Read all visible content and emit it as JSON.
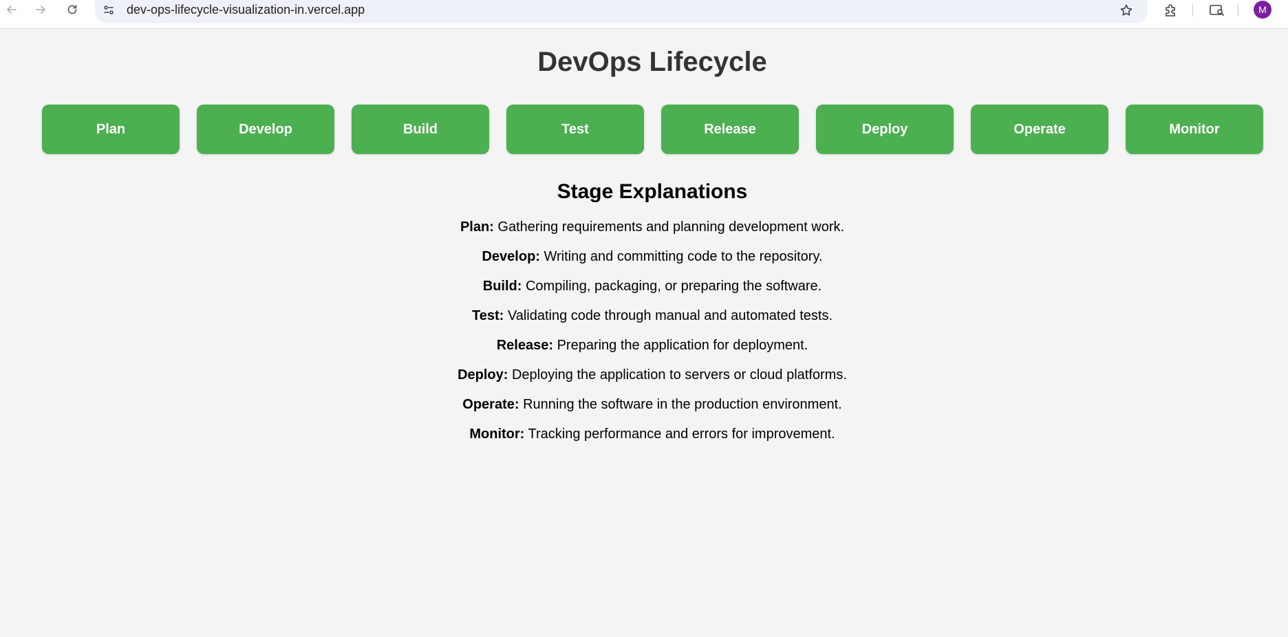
{
  "browser": {
    "url": "dev-ops-lifecycle-visualization-in.vercel.app",
    "profile_initial": "M",
    "icons": [
      "back-icon",
      "forward-icon",
      "reload-icon",
      "site-info-icon",
      "star-icon",
      "extensions-icon",
      "tab-search-icon"
    ]
  },
  "page": {
    "title": "DevOps Lifecycle",
    "stages": [
      "Plan",
      "Develop",
      "Build",
      "Test",
      "Release",
      "Deploy",
      "Operate",
      "Monitor"
    ],
    "explanations_heading": "Stage Explanations",
    "explanations": [
      {
        "name": "Plan:",
        "text": " Gathering requirements and planning development work."
      },
      {
        "name": "Develop:",
        "text": " Writing and committing code to the repository."
      },
      {
        "name": "Build:",
        "text": " Compiling, packaging, or preparing the software."
      },
      {
        "name": "Test:",
        "text": " Validating code through manual and automated tests."
      },
      {
        "name": "Release:",
        "text": " Preparing the application for deployment."
      },
      {
        "name": "Deploy:",
        "text": " Deploying the application to servers or cloud platforms."
      },
      {
        "name": "Operate:",
        "text": " Running the software in the production environment."
      },
      {
        "name": "Monitor:",
        "text": " Tracking performance and errors for improvement."
      }
    ]
  },
  "colors": {
    "stage_button": "#4caf50",
    "background": "#f4f4f4",
    "title": "#333333"
  }
}
